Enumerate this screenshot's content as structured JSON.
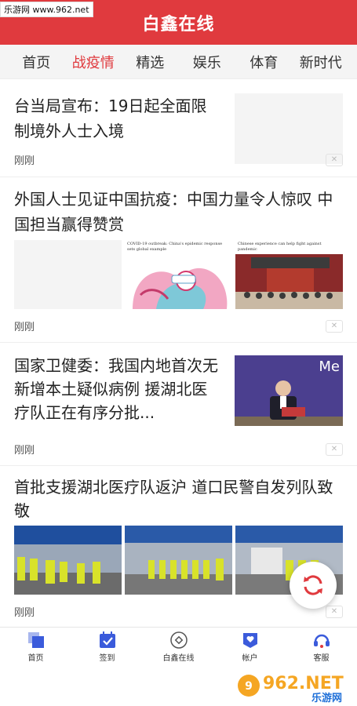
{
  "watermark_top": "乐游网 www.962.net",
  "header": {
    "title": "白鑫在线"
  },
  "tabs": [
    {
      "label": "首页",
      "active": false
    },
    {
      "label": "战疫情",
      "active": true
    },
    {
      "label": "精选",
      "active": false
    },
    {
      "label": "娱乐",
      "active": false
    },
    {
      "label": "体育",
      "active": false
    },
    {
      "label": "新时代",
      "active": false
    }
  ],
  "articles": [
    {
      "title": "台当局宣布：19日起全面限制境外人士入境",
      "time": "刚刚",
      "dismiss": "✕"
    },
    {
      "title": "外国人士见证中国抗疫：中国力量令人惊叹 中国担当赢得赞赏",
      "time": "刚刚",
      "dismiss": "✕",
      "image_captions": [
        "",
        "COVID-19 outbreak: China's epidemic response sets global example",
        "Chinese experience can help fight against pandemic"
      ]
    },
    {
      "title": "国家卫健委：我国内地首次无新增本土疑似病例 援湖北医疗队正在有序分批...",
      "time": "刚刚",
      "dismiss": "✕",
      "thumb_text": "Me"
    },
    {
      "title": "首批支援湖北医疗队返沪 道口民警自发列队致敬",
      "time": "刚刚",
      "dismiss": "✕"
    }
  ],
  "tabbar": [
    {
      "label": "首页",
      "icon": "home-icon"
    },
    {
      "label": "签到",
      "icon": "checkin-calendar-icon"
    },
    {
      "label": "白鑫在线",
      "icon": "online-circle-icon"
    },
    {
      "label": "帐户",
      "icon": "account-heart-icon"
    },
    {
      "label": "客服",
      "icon": "headset-icon"
    }
  ],
  "brand_logo_text": "962.NET",
  "brand_logo_sub": "乐游网",
  "colors": {
    "accent": "#e03a3e",
    "tabbar_icon": "#3b5bdb"
  }
}
